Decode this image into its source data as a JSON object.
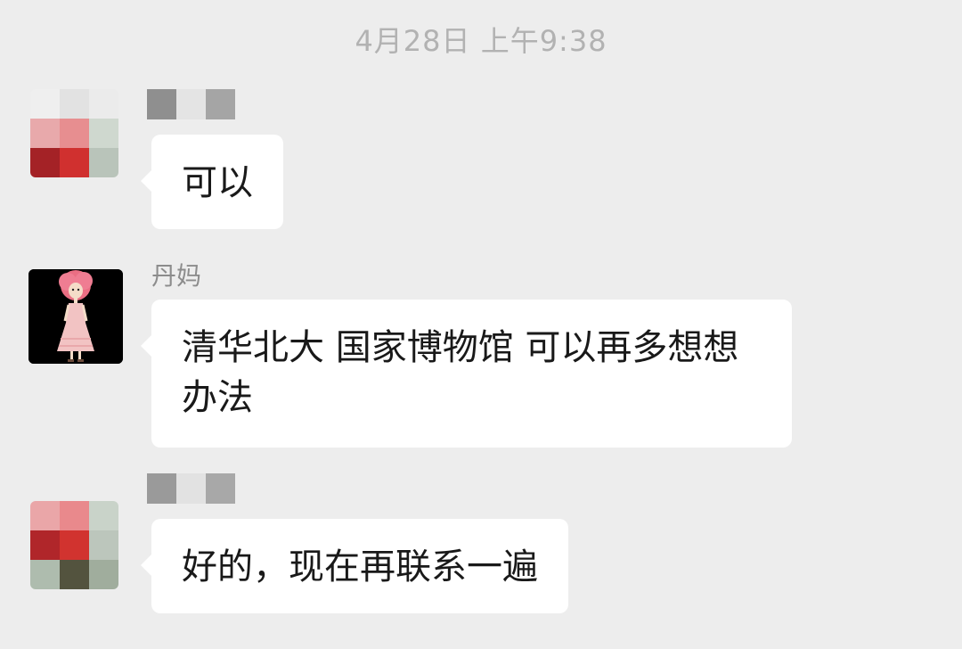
{
  "chat": {
    "timestamp": "4月28日 上午9:38",
    "messages": [
      {
        "sender": "",
        "text": "可以"
      },
      {
        "sender": "丹妈",
        "text": "清华北大 国家博物馆 可以再多想想办法"
      },
      {
        "sender": "",
        "text": "好的，现在再联系一遍"
      }
    ]
  },
  "colors": {
    "background": "#ededed",
    "bubble": "#ffffff",
    "timestamp_text": "#b2b2b2",
    "sender_text": "#8c8c8c",
    "message_text": "#191919"
  }
}
